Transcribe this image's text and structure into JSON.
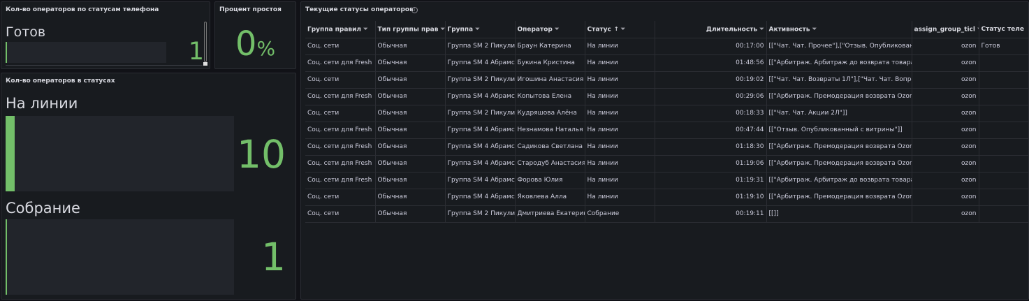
{
  "panel_phone_status": {
    "title": "Кол-во операторов по статусам телефона",
    "label": "Готов",
    "value": "1",
    "fill": 0.0,
    "color": "#73bf69"
  },
  "panel_idle": {
    "title": "Процент простоя",
    "value": "0",
    "unit": "%",
    "color": "#73bf69"
  },
  "panel_status_counts": {
    "title": "Кол-во операторов в статусах",
    "items": [
      {
        "label": "На линии",
        "value": "10",
        "fill": 0.04
      },
      {
        "label": "Собрание",
        "value": "1",
        "fill": 0.0
      }
    ]
  },
  "panel_table": {
    "title": "Текущие статусы операторов",
    "info_icon": "info-circle-icon",
    "columns": [
      "Группа правил",
      "Тип группы прав",
      "Группа",
      "Оператор",
      "Статус",
      "Длительность",
      "Активность",
      "assign_group_ticl",
      "Статус теле"
    ],
    "sorted_column": "Статус",
    "sort_direction": "asc",
    "rows": [
      [
        "Соц. сети",
        "Обычная",
        "Группа SM 2 Пикули",
        "Браун Катерина",
        "На линии",
        "00:17:00",
        "[[\"Чат. Чат. Прочее\"],[\"Отзыв. Опубликован",
        "ozon",
        "Готов"
      ],
      [
        "Соц. сети для Fresh",
        "Обычная",
        "Группа SM 4 Абрамс",
        "Букина Кристина",
        "На линии",
        "01:48:56",
        "[[\"Арбитраж. Арбитраж до возврата товара",
        "ozon",
        ""
      ],
      [
        "Соц. сети",
        "Обычная",
        "Группа SM 2 Пикули",
        "Игошина Анастасия",
        "На линии",
        "00:19:02",
        "[[\"Чат. Чат. Возвраты 1Л\"],[\"Чат. Чат. Вопро",
        "ozon",
        ""
      ],
      [
        "Соц. сети для Fresh",
        "Обычная",
        "Группа SM 4 Абрамс",
        "Копытова Елена",
        "На линии",
        "00:29:06",
        "[[\"Арбитраж. Премодерация возврата Ozon",
        "ozon",
        ""
      ],
      [
        "Соц. сети",
        "Обычная",
        "Группа SM 2 Пикули",
        "Кудряшова Алёна",
        "На линии",
        "00:18:33",
        "[[\"Чат. Чат. Акции 2Л\"]]",
        "ozon",
        ""
      ],
      [
        "Соц. сети для Fresh",
        "Обычная",
        "Группа SM 4 Абрамс",
        "Незнамова Наталья",
        "На линии",
        "00:47:44",
        "[[\"Отзыв. Опубликованный с витрины\"]]",
        "ozon",
        ""
      ],
      [
        "Соц. сети для Fresh",
        "Обычная",
        "Группа SM 4 Абрамс",
        "Садикова Светлана",
        "На линии",
        "01:18:30",
        "[[\"Арбитраж. Премодерация возврата Ozon",
        "ozon",
        ""
      ],
      [
        "Соц. сети для Fresh",
        "Обычная",
        "Группа SM 4 Абрамс",
        "Стародуб Анастасия",
        "На линии",
        "01:19:06",
        "[[\"Арбитраж. Премодерация возврата Ozon",
        "ozon",
        ""
      ],
      [
        "Соц. сети для Fresh",
        "Обычная",
        "Группа SM 4 Абрамс",
        "Форова Юлия",
        "На линии",
        "01:19:31",
        "[[\"Арбитраж. Арбитраж до возврата товара",
        "ozon",
        ""
      ],
      [
        "Соц. сети",
        "Обычная",
        "Группа SM 4 Абрамс",
        "Яковлева Алла",
        "На линии",
        "01:19:10",
        "[[\"Арбитраж. Премодерация возврата Ozon",
        "ozon",
        ""
      ],
      [
        "Соц. сети",
        "Обычная",
        "Группа SM 2 Пикули",
        "Дмитриева Екатерин",
        "Собрание",
        "00:19:11",
        "[[]]",
        "ozon",
        ""
      ]
    ]
  }
}
